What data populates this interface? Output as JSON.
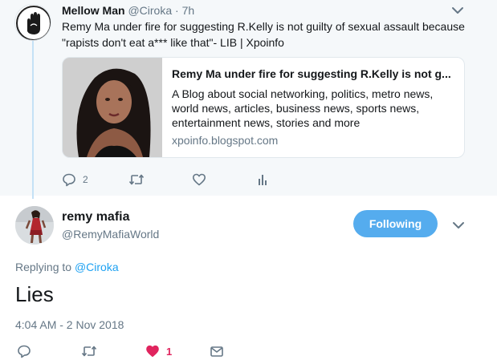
{
  "parent_tweet": {
    "display_name": "Mellow Man",
    "handle": "@Ciroka",
    "separator": " · ",
    "time": "7h",
    "text": "Remy Ma under fire for suggesting R.Kelly is not guilty of sexual assault because \"rapists don't eat a*** like that\"- LIB | Xpoinfo",
    "card": {
      "title": "Remy Ma under fire for suggesting R.Kelly is not g...",
      "description": "A Blog about social networking, politics, metro news, world news, articles, business news, sports news, entertainment news, stories and more",
      "domain": "xpoinfo.blogspot.com"
    },
    "actions": {
      "reply_count": "2",
      "retweet_count": "",
      "like_count": ""
    }
  },
  "main_tweet": {
    "display_name": "remy mafia",
    "handle": "@RemyMafiaWorld",
    "follow_button_label": "Following",
    "replying_prefix": "Replying to ",
    "replying_to": "@Ciroka",
    "text": "Lies",
    "timestamp": "4:04 AM - 2 Nov 2018",
    "actions": {
      "like_count": "1"
    }
  },
  "colors": {
    "accent": "#1da1f2",
    "follow_button": "#55acee",
    "like_active": "#e0245e",
    "muted": "#657786",
    "thread_line": "#c4e1f6"
  },
  "icons": [
    "avatar-image",
    "chevron-down-icon",
    "reply-icon",
    "retweet-icon",
    "heart-icon",
    "analytics-icon",
    "mail-icon"
  ]
}
